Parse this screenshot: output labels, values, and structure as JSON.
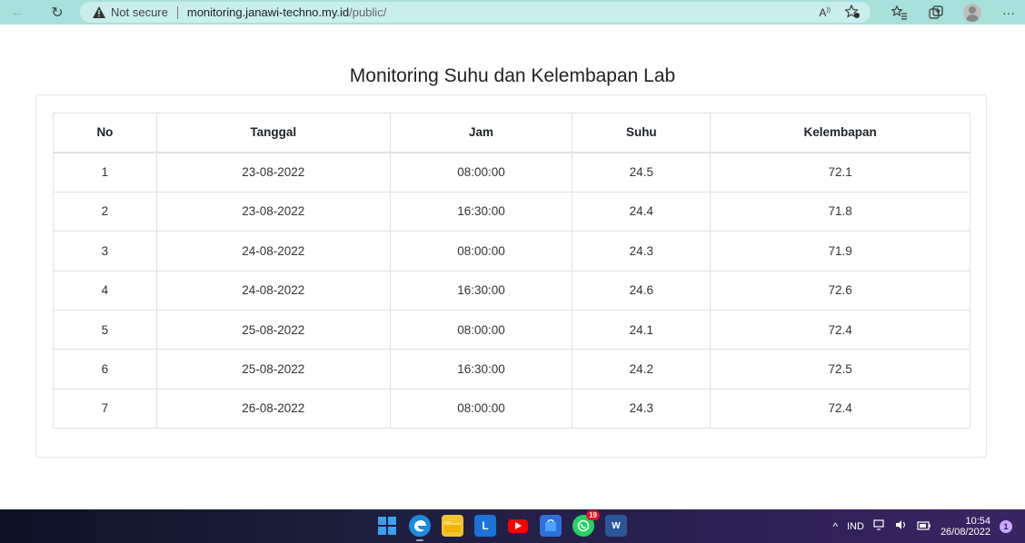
{
  "browser": {
    "back_glyph": "←",
    "reload_glyph": "↻",
    "security_label": "Not secure",
    "url_host": "monitoring.janawi-techno.my.id",
    "url_path": "/public/",
    "read_aloud_glyph": "A",
    "more_glyph": "···"
  },
  "page": {
    "title": "Monitoring Suhu dan Kelembapan Lab"
  },
  "table": {
    "headers": [
      "No",
      "Tanggal",
      "Jam",
      "Suhu",
      "Kelembapan"
    ],
    "rows": [
      [
        "1",
        "23-08-2022",
        "08:00:00",
        "24.5",
        "72.1"
      ],
      [
        "2",
        "23-08-2022",
        "16:30:00",
        "24.4",
        "71.8"
      ],
      [
        "3",
        "24-08-2022",
        "08:00:00",
        "24.3",
        "71.9"
      ],
      [
        "4",
        "24-08-2022",
        "16:30:00",
        "24.6",
        "72.6"
      ],
      [
        "5",
        "25-08-2022",
        "08:00:00",
        "24.1",
        "72.4"
      ],
      [
        "6",
        "25-08-2022",
        "16:30:00",
        "24.2",
        "72.5"
      ],
      [
        "7",
        "26-08-2022",
        "08:00:00",
        "24.3",
        "72.4"
      ]
    ]
  },
  "taskbar": {
    "apps": [
      {
        "name": "start-button",
        "icon": "windows-icon"
      },
      {
        "name": "edge-app",
        "icon": "edge-icon"
      },
      {
        "name": "file-explorer-app",
        "icon": "folder-icon"
      },
      {
        "name": "l-app",
        "icon": "l-icon",
        "letter": "L"
      },
      {
        "name": "youtube-app",
        "icon": "youtube-icon"
      },
      {
        "name": "store-app",
        "icon": "store-icon"
      },
      {
        "name": "whatsapp-app",
        "icon": "whatsapp-icon",
        "badge": "19"
      },
      {
        "name": "word-app",
        "icon": "word-icon",
        "letter": "W"
      }
    ],
    "tray": {
      "chevron": "^",
      "language": "IND",
      "time": "10:54",
      "date": "26/08/2022",
      "notification_count": "1"
    }
  },
  "colors": {
    "toolbar_bg": "#a8e0dc",
    "address_bg": "#c9eeeb",
    "table_border": "#dee2e6"
  }
}
